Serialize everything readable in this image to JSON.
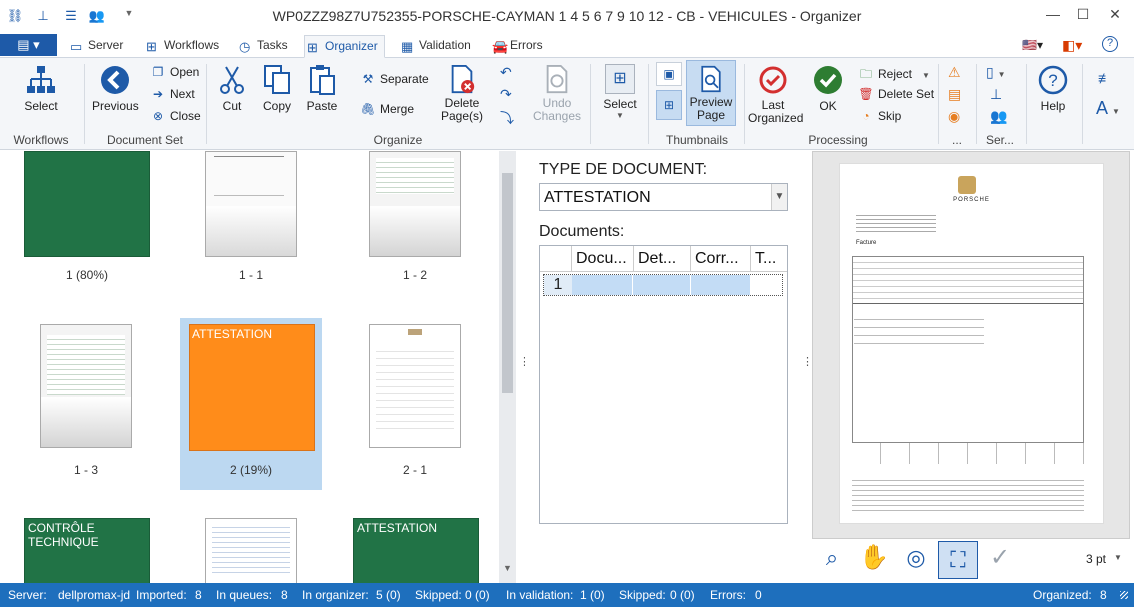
{
  "window": {
    "title": "WP0ZZZ98Z7U752355-PORSCHE-CAYMAN 1 4 5 6 7 9 10 12 - CB - VEHICULES - Organizer"
  },
  "menu": {
    "file_icon": "menu-icon"
  },
  "tabs": [
    {
      "label": "Server"
    },
    {
      "label": "Workflows"
    },
    {
      "label": "Tasks"
    },
    {
      "label": "Organizer"
    },
    {
      "label": "Validation"
    },
    {
      "label": "Errors"
    }
  ],
  "ribbon": {
    "workflows": {
      "select": "Select",
      "group": "Workflows"
    },
    "docset": {
      "previous": "Previous",
      "open": "Open",
      "next": "Next",
      "close": "Close",
      "group": "Document Set"
    },
    "organize": {
      "cut": "Cut",
      "copy": "Copy",
      "paste": "Paste",
      "separate": "Separate",
      "merge": "Merge",
      "delete_pages_1": "Delete",
      "delete_pages_2": "Page(s)",
      "undo_1": "Undo",
      "undo_2": "Changes",
      "group": "Organize"
    },
    "thumbnails": {
      "select": "Select",
      "preview_1": "Preview",
      "preview_2": "Page",
      "group": "Thumbnails"
    },
    "processing": {
      "last_1": "Last",
      "last_2": "Organized",
      "ok": "OK",
      "reject": "Reject",
      "delete_set": "Delete Set",
      "skip": "Skip",
      "group": "Processing"
    },
    "more": {
      "group1": "...",
      "group2": "Ser...",
      "help": "Help"
    }
  },
  "thumbs": [
    {
      "label": "1 (80%)",
      "caption": ""
    },
    {
      "label": "1 - 1",
      "caption": ""
    },
    {
      "label": "1 - 2",
      "caption": ""
    },
    {
      "label": "1 - 3",
      "caption": ""
    },
    {
      "label": "2 (19%)",
      "caption": "ATTESTATION"
    },
    {
      "label": "2 - 1",
      "caption": ""
    },
    {
      "label": "",
      "caption": "CONTRÔLE TECHNIQUE"
    },
    {
      "label": "",
      "caption": ""
    },
    {
      "label": "",
      "caption": "ATTESTATION"
    }
  ],
  "docpanel": {
    "type_label": "TYPE DE DOCUMENT:",
    "type_value": "ATTESTATION",
    "documents_label": "Documents:",
    "columns": [
      "Docu...",
      "Det...",
      "Corr...",
      "T..."
    ],
    "rows": [
      {
        "num": "1"
      }
    ]
  },
  "preview": {
    "brand": "PORSCHE",
    "doc_title": "Facture",
    "zoom": "3 pt"
  },
  "status": {
    "server_label": "Server:",
    "server_value": "dellpromax-jd",
    "imported_label": "Imported:",
    "imported_value": "8",
    "queues_label": "In queues:",
    "queues_value": "8",
    "organizer_label": "In organizer:",
    "organizer_value": "5 (0)",
    "skipped_label": "Skipped:",
    "skipped_value": "0 (0)",
    "validation_label": "In validation:",
    "validation_value": "1 (0)",
    "skipped2_label": "Skipped:",
    "skipped2_value": "0 (0)",
    "errors_label": "Errors:",
    "errors_value": "0",
    "organized_label": "Organized:",
    "organized_value": "8"
  },
  "colors": {
    "accent": "#1e5aa8",
    "status_bar": "#1e6fbd",
    "thumb_green": "#217346",
    "thumb_orange": "#ff8c1a",
    "selected_bg": "#bcd8f1"
  }
}
